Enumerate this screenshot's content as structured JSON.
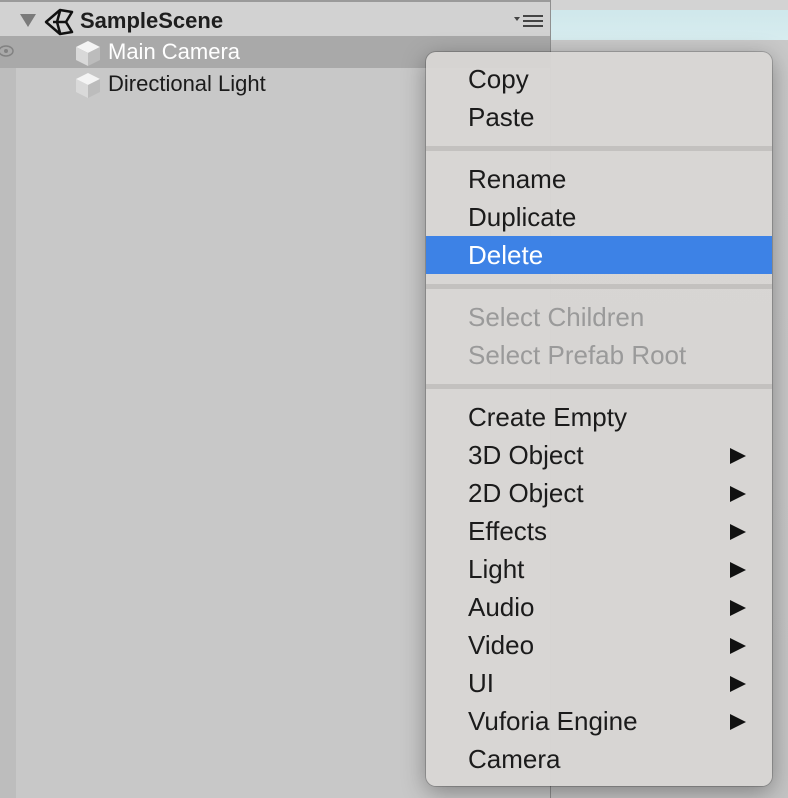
{
  "hierarchy": {
    "scene_name": "SampleScene",
    "items": [
      {
        "label": "Main Camera",
        "selected": true
      },
      {
        "label": "Directional Light",
        "selected": false
      }
    ]
  },
  "context_menu": {
    "group1": [
      {
        "label": "Copy"
      },
      {
        "label": "Paste"
      }
    ],
    "group2": [
      {
        "label": "Rename"
      },
      {
        "label": "Duplicate"
      },
      {
        "label": "Delete",
        "highlighted": true
      }
    ],
    "group3": [
      {
        "label": "Select Children",
        "disabled": true
      },
      {
        "label": "Select Prefab Root",
        "disabled": true
      }
    ],
    "group4": [
      {
        "label": "Create Empty",
        "submenu": false
      },
      {
        "label": "3D Object",
        "submenu": true
      },
      {
        "label": "2D Object",
        "submenu": true
      },
      {
        "label": "Effects",
        "submenu": true
      },
      {
        "label": "Light",
        "submenu": true
      },
      {
        "label": "Audio",
        "submenu": true
      },
      {
        "label": "Video",
        "submenu": true
      },
      {
        "label": "UI",
        "submenu": true
      },
      {
        "label": "Vuforia Engine",
        "submenu": true
      },
      {
        "label": "Camera",
        "submenu": false
      }
    ]
  },
  "colors": {
    "highlight": "#3d82e6",
    "selection_row": "#a9a9a9",
    "disabled_text": "#9a9a9a"
  }
}
